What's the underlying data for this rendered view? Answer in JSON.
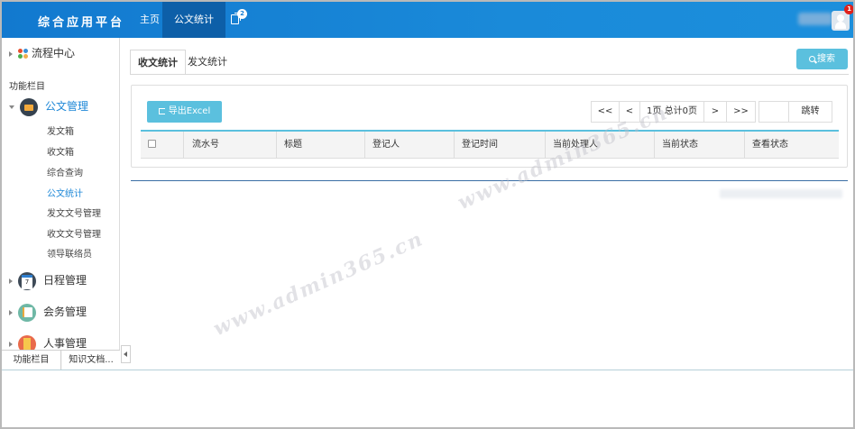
{
  "app": {
    "brand": "综合应用平台",
    "nav": {
      "home": "主页",
      "stats": "公文统计",
      "msg_badge": "2"
    },
    "user_badge": "1",
    "accent_color": "#1a80d5"
  },
  "sidebar": {
    "flow_center": "流程中心",
    "section_title": "功能栏目",
    "doc_group": {
      "label": "公文管理",
      "items": [
        "发文箱",
        "收文箱",
        "综合查询",
        "公文统计",
        "发文文号管理",
        "收文文号管理",
        "领导联络员"
      ],
      "active_index": 3
    },
    "groups": [
      "日程管理",
      "会务管理",
      "人事管理"
    ],
    "tabs": [
      "功能栏目",
      "知识文档..."
    ]
  },
  "main": {
    "tabs": [
      "收文统计",
      "发文统计"
    ],
    "search_label": "搜索",
    "export_label": "导出Excel",
    "pager": {
      "first": "<<",
      "prev": "<",
      "info": "1页 总计0页",
      "next": ">",
      "last": ">>",
      "jump": "跳转"
    },
    "columns": [
      "流水号",
      "标题",
      "登记人",
      "登记时间",
      "当前处理人",
      "当前状态",
      "查看状态"
    ]
  },
  "watermark": "www.admin365.cn"
}
